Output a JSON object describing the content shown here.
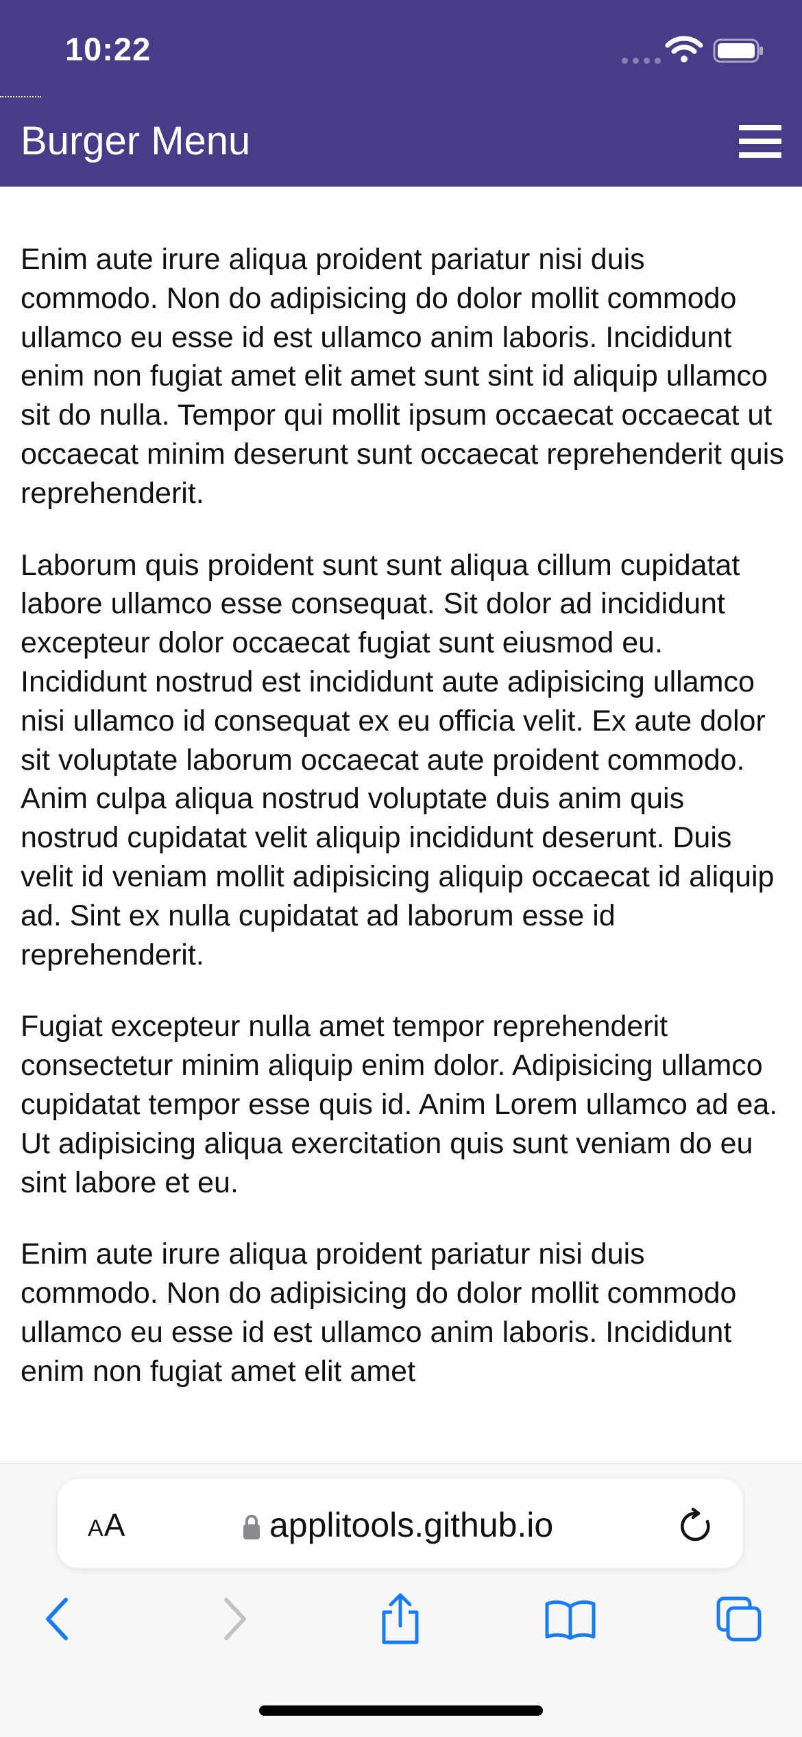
{
  "status_bar": {
    "time": "10:22"
  },
  "app_bar": {
    "title": "Burger Menu",
    "menu_icon": "hamburger-icon"
  },
  "content": {
    "paragraphs": [
      "Enim aute irure aliqua proident pariatur nisi duis commodo. Non do adipisicing do dolor mollit commodo ullamco eu esse id est ullamco anim laboris. Incididunt enim non fugiat amet elit amet sunt sint id aliquip ullamco sit do nulla. Tempor qui mollit ipsum occaecat occaecat ut occaecat minim deserunt sunt occaecat reprehenderit quis reprehenderit.",
      "Laborum quis proident sunt sunt aliqua cillum cupidatat labore ullamco esse consequat. Sit dolor ad incididunt excepteur dolor occaecat fugiat sunt eiusmod eu. Incididunt nostrud est incididunt aute adipisicing ullamco nisi ullamco id consequat ex eu officia velit. Ex aute dolor sit voluptate laborum occaecat aute proident commodo. Anim culpa aliqua nostrud voluptate duis anim quis nostrud cupidatat velit aliquip incididunt deserunt. Duis velit id veniam mollit adipisicing aliquip occaecat id aliquip ad. Sint ex nulla cupidatat ad laborum esse id reprehenderit.",
      "Fugiat excepteur nulla amet tempor reprehenderit consectetur minim aliquip enim dolor. Adipisicing ullamco cupidatat tempor esse quis id. Anim Lorem ullamco ad ea. Ut adipisicing aliqua exercitation quis sunt veniam do eu sint labore et eu.",
      "Enim aute irure aliqua proident pariatur nisi duis commodo. Non do adipisicing do dolor mollit commodo ullamco eu esse id est ullamco anim laboris. Incididunt enim non fugiat amet elit amet"
    ]
  },
  "browser": {
    "text_size_label_small": "A",
    "text_size_label_large": "A",
    "url": "applitools.github.io",
    "accent_color": "#1a7cf5"
  },
  "colors": {
    "header_background": "#473c88",
    "header_text": "#ffffff",
    "body_text": "#111111"
  }
}
